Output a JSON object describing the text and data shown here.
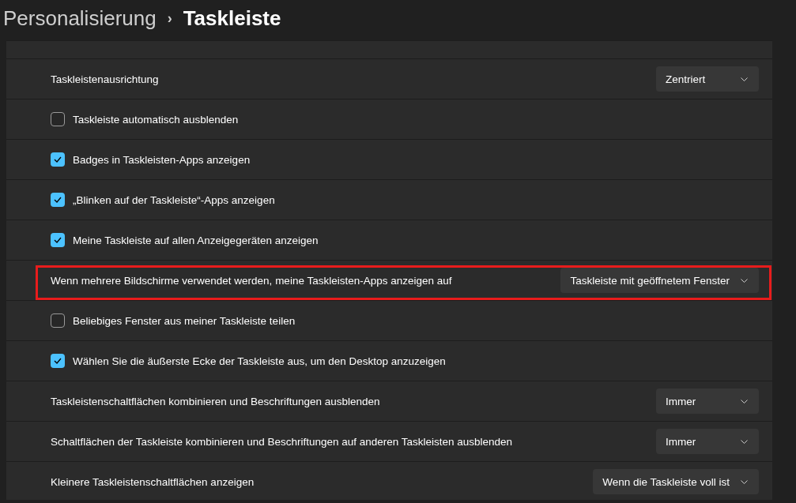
{
  "breadcrumb": {
    "parent": "Personalisierung",
    "separator": "›",
    "current": "Taskleiste"
  },
  "settings": [
    {
      "kind": "dropdown",
      "label": "Taskleistenausrichtung",
      "value": "Zentriert",
      "highlighted": false
    },
    {
      "kind": "checkbox",
      "label": "Taskleiste automatisch ausblenden",
      "checked": false,
      "highlighted": false
    },
    {
      "kind": "checkbox",
      "label": "Badges in Taskleisten-Apps anzeigen",
      "checked": true,
      "highlighted": false
    },
    {
      "kind": "checkbox",
      "label": "„Blinken auf der Taskleiste“-Apps anzeigen",
      "checked": true,
      "highlighted": false
    },
    {
      "kind": "checkbox",
      "label": "Meine Taskleiste auf allen Anzeigegeräten anzeigen",
      "checked": true,
      "highlighted": false
    },
    {
      "kind": "dropdown",
      "label": "Wenn mehrere Bildschirme verwendet werden, meine Taskleisten-Apps anzeigen auf",
      "value": "Taskleiste mit geöffnetem Fenster",
      "highlighted": true
    },
    {
      "kind": "checkbox",
      "label": "Beliebiges Fenster aus meiner Taskleiste teilen",
      "checked": false,
      "highlighted": false
    },
    {
      "kind": "checkbox",
      "label": "Wählen Sie die äußerste Ecke der Taskleiste aus, um den Desktop anzuzeigen",
      "checked": true,
      "highlighted": false
    },
    {
      "kind": "dropdown",
      "label": "Taskleistenschaltflächen kombinieren und Beschriftungen ausblenden",
      "value": "Immer",
      "highlighted": false
    },
    {
      "kind": "dropdown",
      "label": "Schaltflächen der Taskleiste kombinieren und Beschriftungen auf anderen Taskleisten ausblenden",
      "value": "Immer",
      "highlighted": false
    },
    {
      "kind": "dropdown",
      "label": "Kleinere Taskleistenschaltflächen anzeigen",
      "value": "Wenn die Taskleiste voll ist",
      "highlighted": false
    }
  ]
}
